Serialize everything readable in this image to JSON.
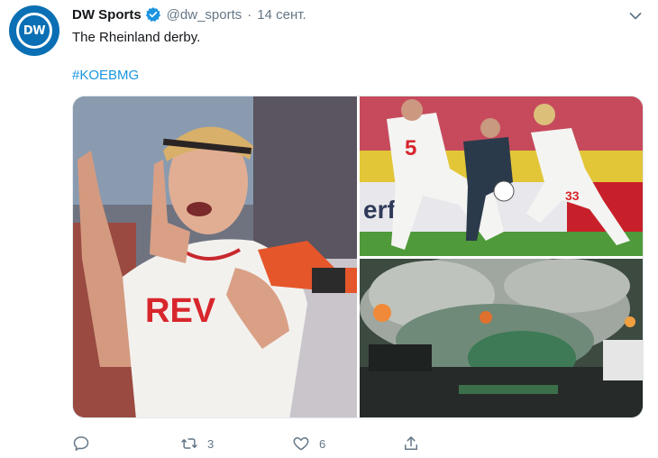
{
  "tweet": {
    "author_name": "DW Sports",
    "handle": "@dw_sports",
    "separator": "·",
    "date": "14 сент.",
    "avatar_text": "DW",
    "text": "The Rheinland derby.",
    "hashtag": "#KOEBMG",
    "images": [
      {
        "icon": "player-celebration-photo",
        "shirt_text": "REV"
      },
      {
        "icon": "match-tackle-photo",
        "shirt_numbers": [
          "5",
          "33"
        ],
        "board_text": "erfl"
      },
      {
        "icon": "fans-pyrotechnics-photo"
      }
    ],
    "actions": {
      "reply_count": "",
      "retweet_count": "3",
      "like_count": "6"
    }
  },
  "colors": {
    "accent": "#1b95e0",
    "brand": "#0a6fb4",
    "muted": "#657786",
    "text": "#14171a"
  }
}
